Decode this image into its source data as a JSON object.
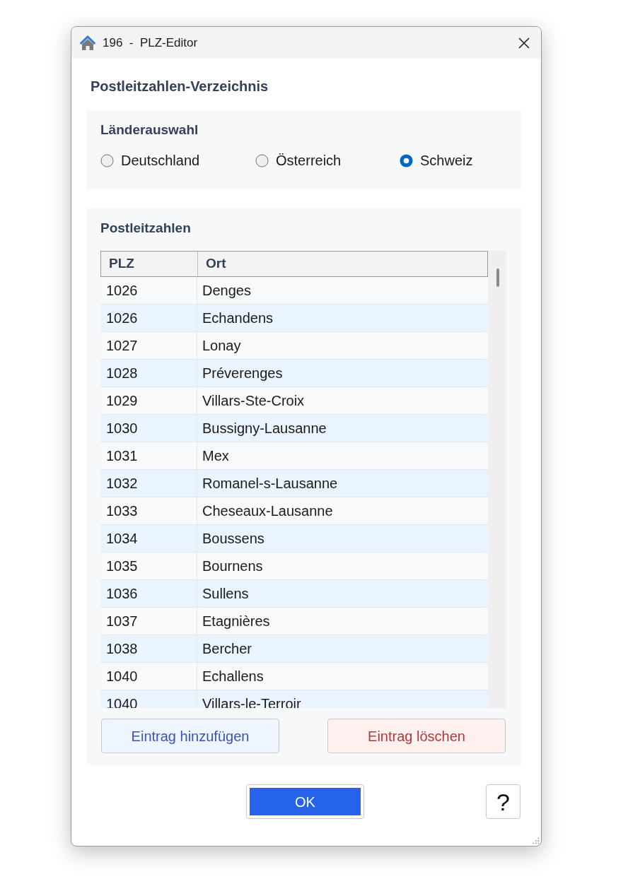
{
  "window": {
    "title": "196  -  PLZ-Editor"
  },
  "heading": "Postleitzahlen-Verzeichnis",
  "country_group": {
    "label": "Länderauswahl",
    "options": [
      {
        "label": "Deutschland",
        "selected": false
      },
      {
        "label": "Österreich",
        "selected": false
      },
      {
        "label": "Schweiz",
        "selected": true
      }
    ]
  },
  "postcode_group": {
    "label": "Postleitzahlen",
    "table": {
      "columns": [
        "PLZ",
        "Ort"
      ],
      "rows": [
        [
          "1026",
          "Denges"
        ],
        [
          "1026",
          "Echandens"
        ],
        [
          "1027",
          "Lonay"
        ],
        [
          "1028",
          "Préverenges"
        ],
        [
          "1029",
          "Villars-Ste-Croix"
        ],
        [
          "1030",
          "Bussigny-Lausanne"
        ],
        [
          "1031",
          "Mex"
        ],
        [
          "1032",
          "Romanel-s-Lausanne"
        ],
        [
          "1033",
          "Cheseaux-Lausanne"
        ],
        [
          "1034",
          "Boussens"
        ],
        [
          "1035",
          "Bournens"
        ],
        [
          "1036",
          "Sullens"
        ],
        [
          "1037",
          "Etagnières"
        ],
        [
          "1038",
          "Bercher"
        ],
        [
          "1040",
          "Echallens"
        ],
        [
          "1040",
          "Villars-le-Terroir"
        ]
      ]
    },
    "buttons": [
      {
        "label": "Eintrag hinzufügen",
        "kind": "add"
      },
      {
        "label": "Eintrag löschen",
        "kind": "delete"
      }
    ]
  },
  "footer": {
    "ok_button": "OK",
    "help_button": "?"
  }
}
